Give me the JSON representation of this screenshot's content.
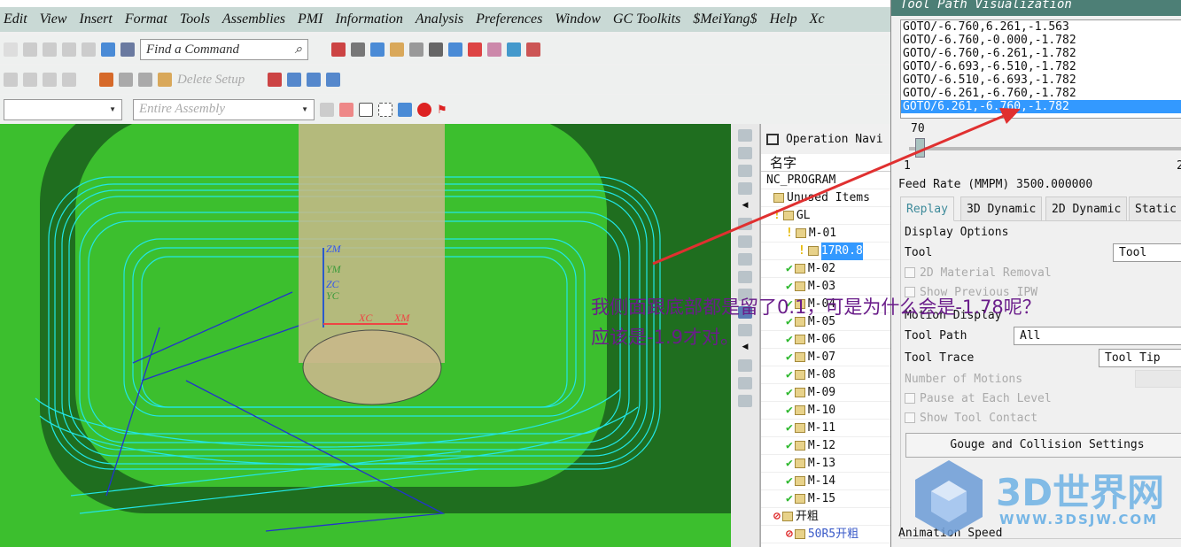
{
  "menu": [
    "Edit",
    "View",
    "Insert",
    "Format",
    "Tools",
    "Assemblies",
    "PMI",
    "Information",
    "Analysis",
    "Preferences",
    "Window",
    "GC Toolkits",
    "$MeiYang$",
    "Help",
    "Xc"
  ],
  "toolbar": {
    "find_command_placeholder": "Find a Command",
    "delete_setup": "Delete Setup",
    "filter_value": "",
    "scope_value": "Entire Assembly"
  },
  "viewport": {
    "axis_labels": [
      "ZM",
      "YM",
      "ZC",
      "YC",
      "XC",
      "XM"
    ],
    "colors": {
      "background": "#3cbf2e",
      "toolpath": "#22e6e6",
      "frame": "#1f6e1f"
    }
  },
  "annotation": {
    "line1": "我侧面跟底部都是留了0.1，可是为什么会是-1.78呢？",
    "line2": "应该是-1.9才对。",
    "color": "#6a1d8a",
    "arrow_color": "#e03030"
  },
  "navigator": {
    "title": "Operation Navi",
    "column": "名字",
    "root": "NC_PROGRAM",
    "items": [
      {
        "label": "Unused Items",
        "status": "",
        "indent": 1
      },
      {
        "label": "GL",
        "status": "warn",
        "indent": 1
      },
      {
        "label": "M-01",
        "status": "warn",
        "indent": 2
      },
      {
        "label": "17R0.8",
        "status": "warn",
        "indent": 3,
        "selected": true
      },
      {
        "label": "M-02",
        "status": "ok",
        "indent": 2
      },
      {
        "label": "M-03",
        "status": "ok",
        "indent": 2
      },
      {
        "label": "M-04",
        "status": "ok",
        "indent": 2
      },
      {
        "label": "M-05",
        "status": "ok",
        "indent": 2
      },
      {
        "label": "M-06",
        "status": "ok",
        "indent": 2
      },
      {
        "label": "M-07",
        "status": "ok",
        "indent": 2
      },
      {
        "label": "M-08",
        "status": "ok",
        "indent": 2
      },
      {
        "label": "M-09",
        "status": "ok",
        "indent": 2
      },
      {
        "label": "M-10",
        "status": "ok",
        "indent": 2
      },
      {
        "label": "M-11",
        "status": "ok",
        "indent": 2
      },
      {
        "label": "M-12",
        "status": "ok",
        "indent": 2
      },
      {
        "label": "M-13",
        "status": "ok",
        "indent": 2
      },
      {
        "label": "M-14",
        "status": "ok",
        "indent": 2
      },
      {
        "label": "M-15",
        "status": "ok",
        "indent": 2
      },
      {
        "label": "开粗",
        "status": "stop",
        "indent": 1
      },
      {
        "label": "50R5开粗",
        "status": "stop",
        "indent": 2
      }
    ]
  },
  "dialog": {
    "title": "Tool Path Visualization",
    "goto": [
      "GOTO/-6.760,6.261,-1.563",
      "GOTO/-6.760,-0.000,-1.782",
      "GOTO/-6.760,-6.261,-1.782",
      "GOTO/-6.693,-6.510,-1.782",
      "GOTO/-6.510,-6.693,-1.782",
      "GOTO/-6.261,-6.760,-1.782",
      "GOTO/6.261,-6.760,-1.782"
    ],
    "selected_index": 6,
    "slider": {
      "value": "70",
      "min": "1",
      "max": "2"
    },
    "feed_rate": "Feed Rate (MMPM) 3500.000000",
    "tabs": [
      "Replay",
      "3D Dynamic",
      "2D Dynamic",
      "Static"
    ],
    "display_options": "Display Options",
    "tool_label": "Tool",
    "tool_value": "Tool",
    "mat_removal": "2D Material Removal",
    "show_ipw": "Show Previous IPW",
    "motion_display": "Motion Display",
    "tool_path_label": "Tool Path",
    "tool_path_value": "All",
    "tool_trace_label": "Tool Trace",
    "tool_trace_value": "Tool Tip",
    "num_motions": "Number of Motions",
    "pause": "Pause at Each Level",
    "contact": "Show Tool Contact",
    "gouge_button": "Gouge and Collision Settings",
    "anim_speed": "Animation Speed"
  },
  "watermark": {
    "name": "3D世界网",
    "url": "WWW.3DSJW.COM"
  }
}
